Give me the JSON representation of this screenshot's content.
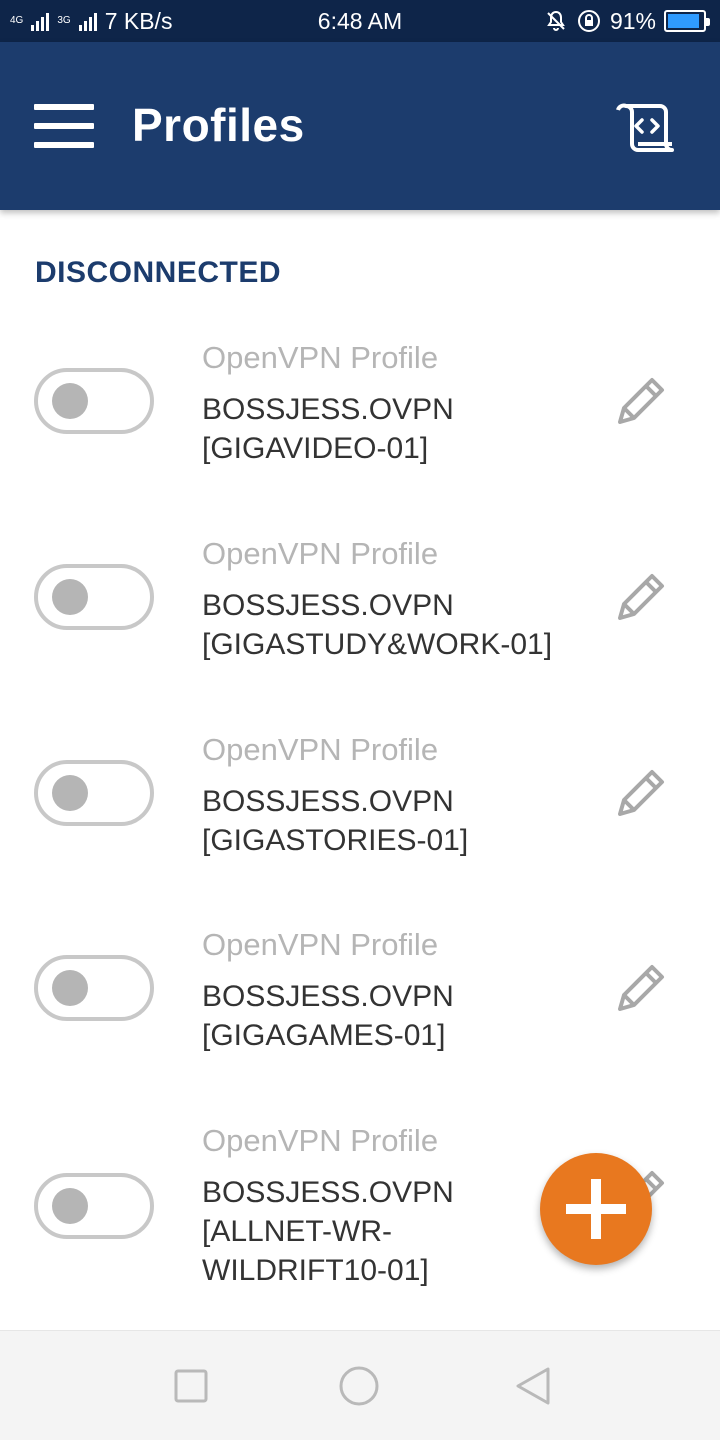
{
  "status_bar": {
    "network_tag": "4G",
    "network_tag_2": "3G",
    "speed": "7 KB/s",
    "time": "6:48 AM",
    "battery": "91%",
    "battery_level": 0.91
  },
  "app_bar": {
    "title": "Profiles"
  },
  "section": {
    "header": "DISCONNECTED"
  },
  "profiles": [
    {
      "type": "OpenVPN Profile",
      "name": "BOSSJESS.OVPN [GIGAVIDEO-01]",
      "connected": false
    },
    {
      "type": "OpenVPN Profile",
      "name": "BOSSJESS.OVPN [GIGASTUDY&WORK-01]",
      "connected": false
    },
    {
      "type": "OpenVPN Profile",
      "name": "BOSSJESS.OVPN [GIGASTORIES-01]",
      "connected": false
    },
    {
      "type": "OpenVPN Profile",
      "name": "BOSSJESS.OVPN [GIGAGAMES-01]",
      "connected": false
    },
    {
      "type": "OpenVPN Profile",
      "name": "BOSSJESS.OVPN [ALLNET-WR-WILDRIFT10-01]",
      "connected": false
    }
  ],
  "icons": {
    "menu": "hamburger-menu-icon",
    "import": "import-profile-icon",
    "edit": "pencil-icon",
    "add": "plus-icon",
    "nav_recent": "square-icon",
    "nav_home": "circle-icon",
    "nav_back": "triangle-back-icon"
  },
  "colors": {
    "app_bar": "#1c3c6d",
    "status_bar": "#0e2549",
    "accent_fab": "#e8781f",
    "section_header": "#1c3c6d",
    "toggle_off": "#b5b5b5"
  }
}
